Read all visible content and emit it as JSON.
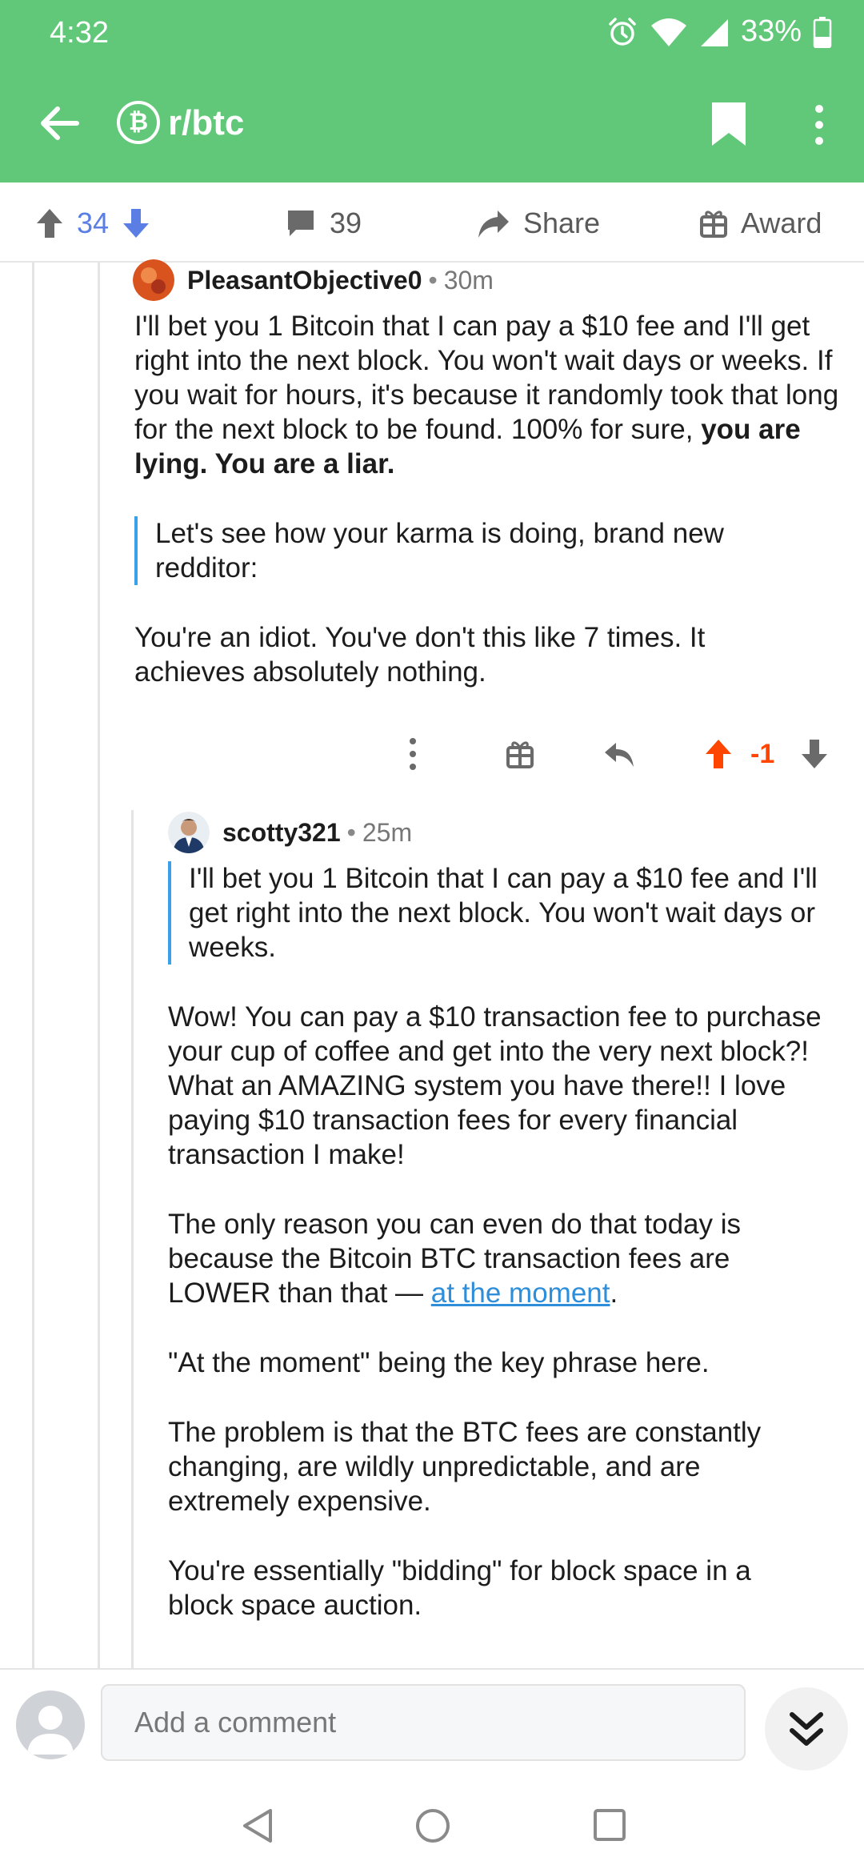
{
  "status_bar": {
    "time": "4:32",
    "battery": "33%"
  },
  "app_bar": {
    "subreddit": "r/btc",
    "sub_icon_glyph": "₿"
  },
  "post_actions": {
    "score": "34",
    "comments": "39",
    "share_label": "Share",
    "award_label": "Award"
  },
  "comment1": {
    "author": "PleasantObjective0",
    "age": "30m",
    "p1_plain": "I'll bet you 1 Bitcoin that I can pay a $10 fee and I'll get right into the next block.  You won't wait days or weeks.  If you wait for hours, it's because it randomly took that long for the next block to be found. 100% for sure, ",
    "p1_bold": "you are lying.  You are a liar.",
    "quote": "Let's see how your karma is doing, brand new redditor:",
    "p2": "You're an idiot.  You've don't this like 7 times.  It achieves absolutely nothing.",
    "score": "-1"
  },
  "comment2": {
    "author": "scotty321",
    "age": "25m",
    "quote": "I'll bet you 1 Bitcoin that I can pay a $10 fee and I'll get right into the next block. You won't wait days or weeks.",
    "p1": "Wow! You can pay a $10 transaction fee to purchase your cup of coffee and get into the very next block?! What an AMAZING system you have there!! I love paying $10 transaction fees for every financial transaction I make!",
    "p2_plain": "The only reason you can even do that today is because the Bitcoin BTC transaction fees are LOWER than that — ",
    "p2_link": "at the moment",
    "p2_end": ".",
    "p3": "\"At the moment\" being the key phrase here.",
    "p4": "The problem is that the BTC fees are constantly changing, are wildly unpredictable, and are extremely expensive.",
    "p5": "You're essentially \"bidding\" for block space in a block space auction."
  },
  "compose": {
    "placeholder": "Add a comment"
  },
  "colors": {
    "header": "#60c878",
    "upvote": "#ff4500",
    "post_vote": "#5b7ee5",
    "link": "#2e8ed9",
    "quote_bar": "#3aa0ea"
  }
}
